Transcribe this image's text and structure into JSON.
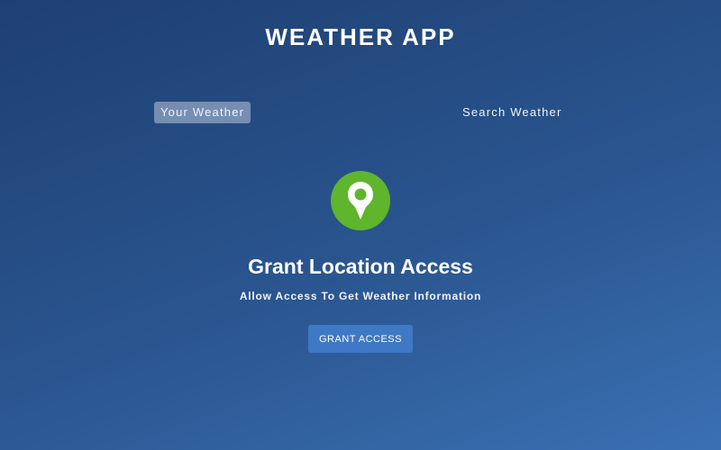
{
  "app": {
    "title": "WEATHER APP"
  },
  "tabs": [
    {
      "label": "Your Weather",
      "active": true
    },
    {
      "label": "Search Weather",
      "active": false
    }
  ],
  "grant_location": {
    "icon": "location-pin-icon",
    "heading": "Grant Location Access",
    "subtext": "Allow Access To Get Weather Information",
    "button_label": "GRANT ACCESS"
  },
  "colors": {
    "background_top": "#1e3f72",
    "background_bottom": "#3a70b3",
    "pin_circle": "#5fb52c",
    "button": "#3f78c4",
    "active_tab": "#dbe2ef"
  }
}
